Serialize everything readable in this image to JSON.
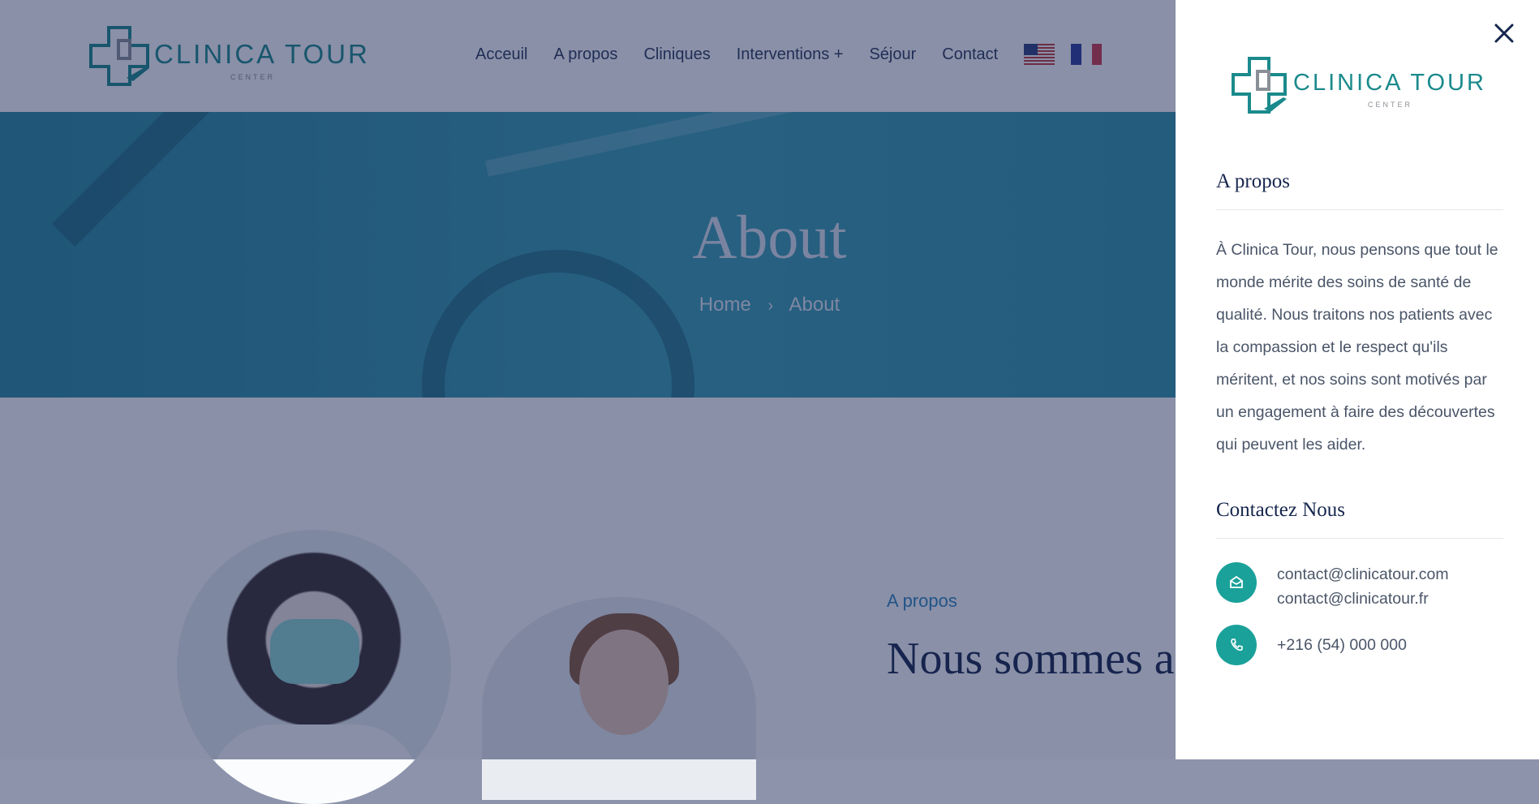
{
  "brand": {
    "name": "CLINICA TOUR",
    "tagline": "CENTER"
  },
  "nav": {
    "items": [
      "Acceuil",
      "A propos",
      "Cliniques",
      "Interventions +",
      "Séjour",
      "Contact"
    ],
    "languages": [
      "English",
      "Français"
    ]
  },
  "hero": {
    "title": "About",
    "breadcrumb": {
      "home": "Home",
      "current": "About"
    }
  },
  "about_section": {
    "label": "A propos",
    "heading": "Nous sommes a disposition"
  },
  "panel": {
    "about_heading": "A propos",
    "about_text": "À Clinica Tour, nous pensons que tout le monde mérite des soins de santé de qualité. Nous traitons nos patients avec la compassion et le respect qu'ils méritent, et nos soins sont motivés par un engagement à faire des découvertes qui peuvent les aider.",
    "contact_heading": "Contactez Nous",
    "emails": [
      "contact@clinicatour.com",
      "contact@clinicatour.fr"
    ],
    "phone": "+216 (54) 000 000"
  },
  "colors": {
    "teal": "#1aa19a",
    "navy": "#16264d",
    "overlay": "rgba(22,34,80,0.5)"
  },
  "icons": [
    "close-icon",
    "mail-icon",
    "phone-icon"
  ]
}
